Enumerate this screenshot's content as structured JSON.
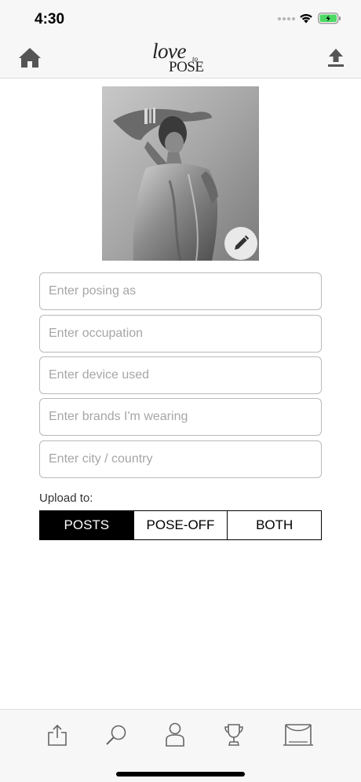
{
  "status_bar": {
    "time": "4:30"
  },
  "header": {
    "logo": {
      "line1": "love",
      "line2": "to",
      "line3": "POSE"
    }
  },
  "photo": {
    "icon": "pencil-icon"
  },
  "form": {
    "posing_as_placeholder": "Enter posing as",
    "occupation_placeholder": "Enter occupation",
    "device_placeholder": "Enter device used",
    "brands_placeholder": "Enter brands I'm wearing",
    "city_placeholder": "Enter city / country"
  },
  "upload": {
    "label": "Upload to:",
    "options": [
      "POSTS",
      "POSE-OFF",
      "BOTH"
    ],
    "selected": "POSTS"
  },
  "tab_bar": {
    "icons": [
      "share-icon",
      "search-icon",
      "profile-icon",
      "trophy-icon",
      "stage-icon"
    ]
  },
  "colors": {
    "accent": "#000000",
    "battery": "#4cd964"
  }
}
